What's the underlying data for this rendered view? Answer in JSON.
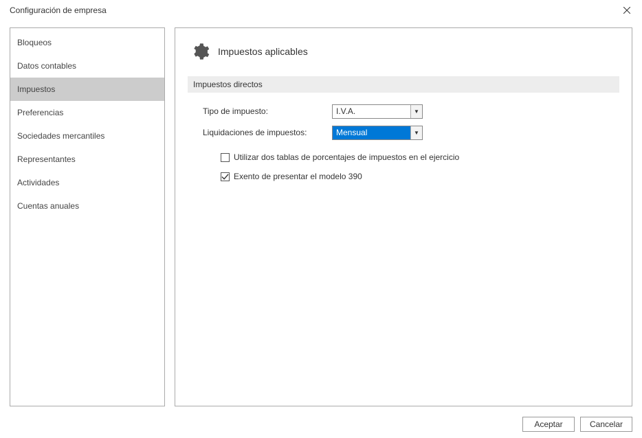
{
  "window": {
    "title": "Configuración de empresa",
    "close_aria": "Cerrar"
  },
  "sidebar": {
    "items": [
      {
        "label": "Bloqueos",
        "selected": false
      },
      {
        "label": "Datos contables",
        "selected": false
      },
      {
        "label": "Impuestos",
        "selected": true
      },
      {
        "label": "Preferencias",
        "selected": false
      },
      {
        "label": "Sociedades mercantiles",
        "selected": false
      },
      {
        "label": "Representantes",
        "selected": false
      },
      {
        "label": "Actividades",
        "selected": false
      },
      {
        "label": "Cuentas anuales",
        "selected": false
      }
    ]
  },
  "panel": {
    "title": "Impuestos aplicables",
    "section_header": "Impuestos directos",
    "fields": {
      "tipo_label": "Tipo de impuesto:",
      "tipo_value": "I.V.A.",
      "liquidaciones_label": "Liquidaciones de impuestos:",
      "liquidaciones_value": "Mensual"
    },
    "checkboxes": {
      "dos_tablas": {
        "label": "Utilizar dos tablas de porcentajes de impuestos en el ejercicio",
        "checked": false
      },
      "exento_390": {
        "label": "Exento de presentar el modelo 390",
        "checked": true
      }
    }
  },
  "buttons": {
    "accept": "Aceptar",
    "cancel": "Cancelar"
  }
}
